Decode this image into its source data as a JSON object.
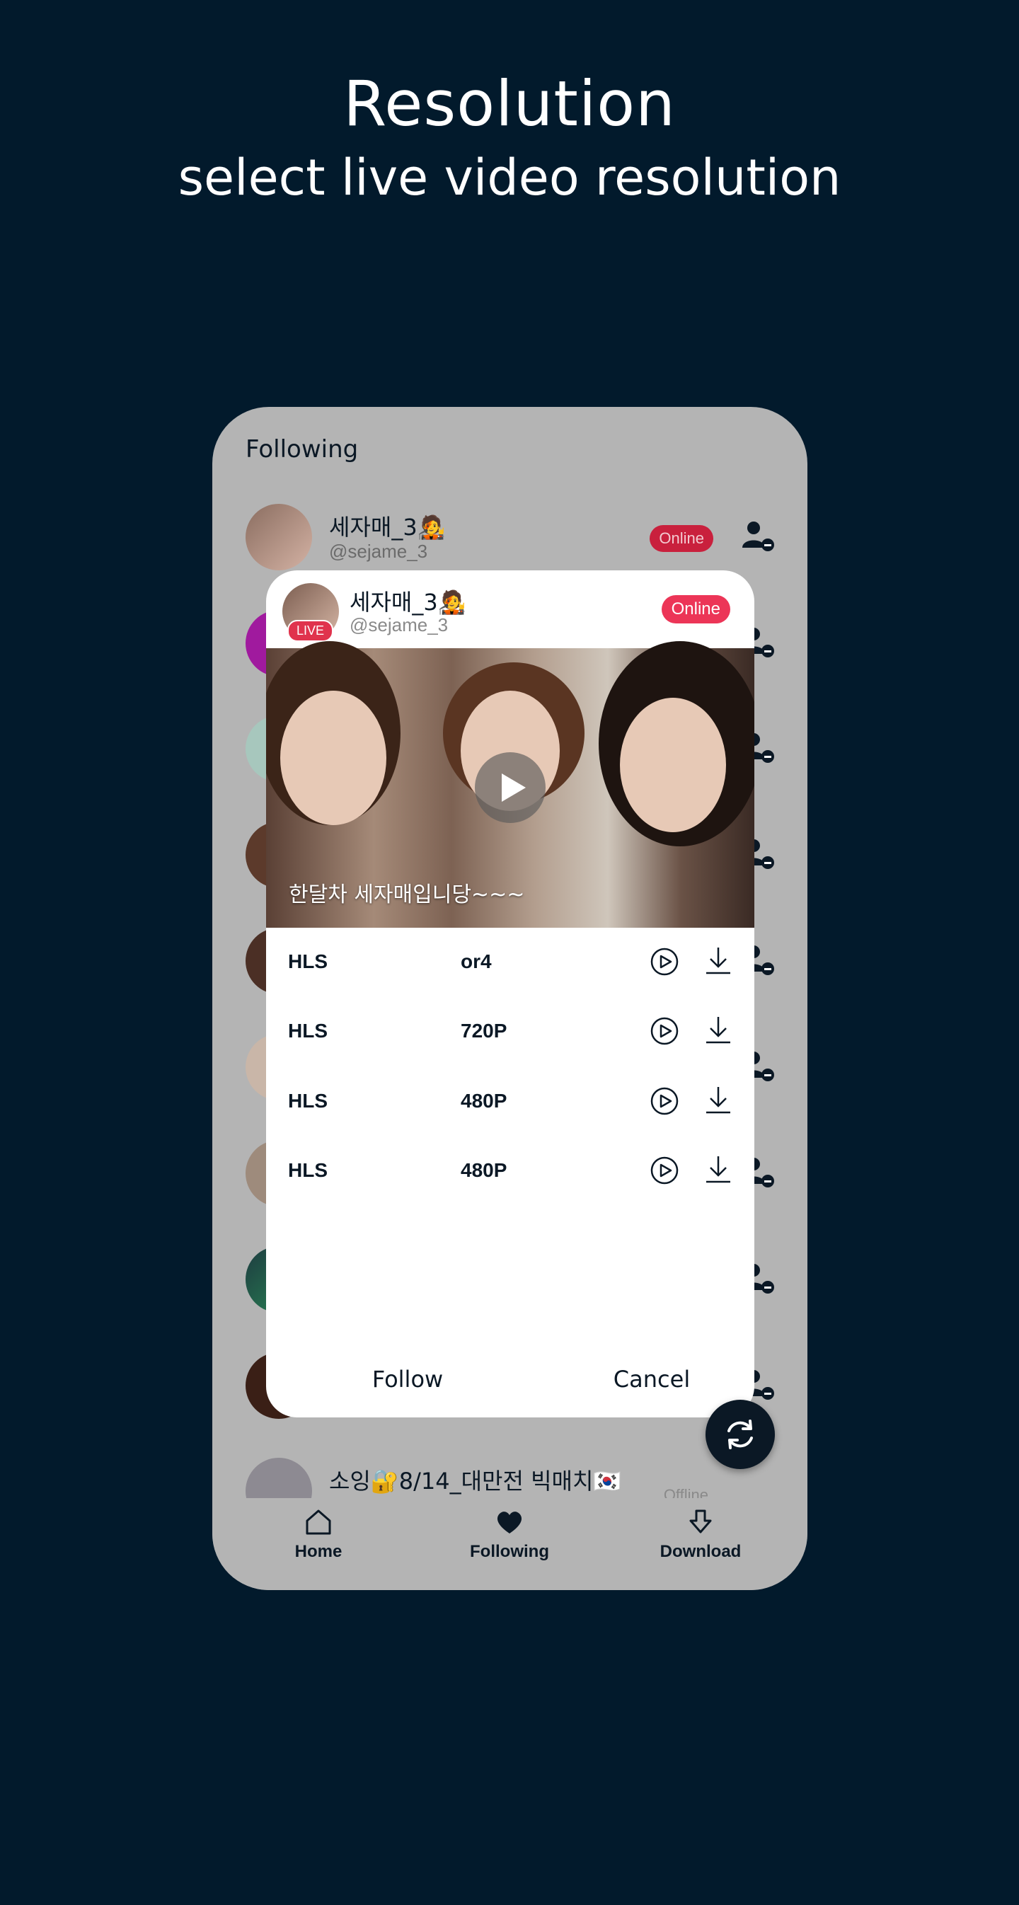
{
  "promo": {
    "title": "Resolution",
    "subtitle": "select live video resolution"
  },
  "screen": {
    "title": "Following",
    "rows": [
      {
        "name": "세자매_3🧑‍🎤",
        "handle": "@sejame_3",
        "status": "Online"
      },
      {
        "name": "소잉🔐8/14_대만전 빅매치🇰🇷",
        "handle": "",
        "status": "Offline"
      }
    ]
  },
  "modal": {
    "name": "세자매_3🧑‍🎤",
    "handle": "@sejame_3",
    "live_badge": "LIVE",
    "status": "Online",
    "caption": "한달차 세자매입니당~~~",
    "resolutions": [
      {
        "protocol": "HLS",
        "quality": "or4"
      },
      {
        "protocol": "HLS",
        "quality": "720P"
      },
      {
        "protocol": "HLS",
        "quality": "480P"
      },
      {
        "protocol": "HLS",
        "quality": "480P"
      }
    ],
    "follow_label": "Follow",
    "cancel_label": "Cancel"
  },
  "nav": {
    "home": "Home",
    "following": "Following",
    "download": "Download"
  },
  "colors": {
    "background": "#021a2c",
    "online": "#ec3557",
    "live": "#e0334d"
  }
}
